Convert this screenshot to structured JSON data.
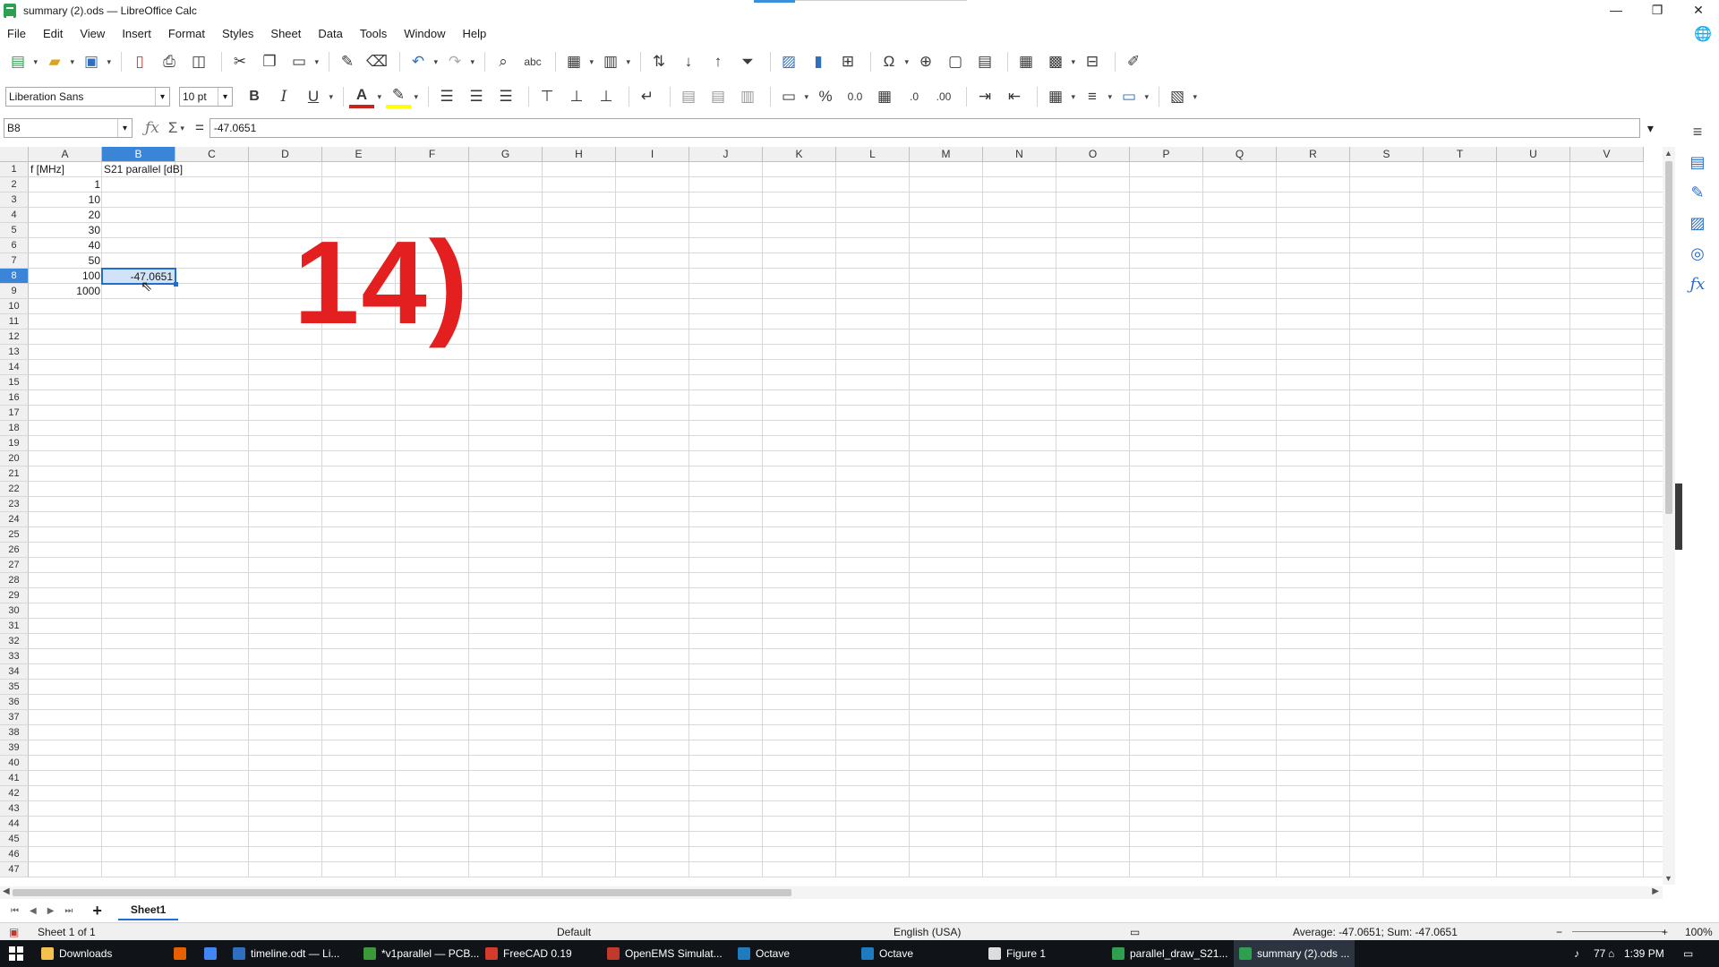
{
  "window": {
    "title": "summary (2).ods — LibreOffice Calc",
    "minimize": "—",
    "restore": "❐",
    "close": "✕"
  },
  "menu": [
    "File",
    "Edit",
    "View",
    "Insert",
    "Format",
    "Styles",
    "Sheet",
    "Data",
    "Tools",
    "Window",
    "Help"
  ],
  "format_toolbar": {
    "font_name": "Liberation Sans",
    "font_size": "10 pt",
    "bold": "B",
    "italic": "I",
    "underline": "U",
    "percent": "%",
    "number": "0.0"
  },
  "formula_bar": {
    "cell_ref": "B8",
    "formula": "-47.0651"
  },
  "columns": [
    "A",
    "B",
    "C",
    "D",
    "E",
    "F",
    "G",
    "H",
    "I",
    "J",
    "K",
    "L",
    "M",
    "N",
    "O",
    "P",
    "Q",
    "R",
    "S",
    "T",
    "U",
    "V"
  ],
  "selected_column": "B",
  "selected_row": "8",
  "rows": [
    "1",
    "2",
    "3",
    "4",
    "5",
    "6",
    "7",
    "8",
    "9",
    "10",
    "11",
    "12",
    "13",
    "14",
    "15",
    "16",
    "17",
    "18",
    "19",
    "20",
    "21",
    "22",
    "23",
    "24",
    "25",
    "26",
    "27",
    "28",
    "29",
    "30",
    "31",
    "32",
    "33",
    "34",
    "35",
    "36",
    "37",
    "38",
    "39",
    "40",
    "41",
    "42",
    "43",
    "44",
    "45",
    "46",
    "47"
  ],
  "cells": {
    "A1": "f [MHz]",
    "B1": "S21 parallel [dB]",
    "A2": "1",
    "A3": "10",
    "A4": "20",
    "A5": "30",
    "A6": "40",
    "A7": "50",
    "A8": "100",
    "B8": "-47.0651",
    "A9": "1000"
  },
  "annotation": "14)",
  "sheet_tabs": {
    "add": "+",
    "active": "Sheet1"
  },
  "status": {
    "sheet": "Sheet 1 of 1",
    "page_style": "Default",
    "language": "English (USA)",
    "selection": "Average: -47.0651; Sum: -47.0651",
    "zoom": "100%"
  },
  "taskbar": {
    "items": [
      {
        "label": "Downloads",
        "color": "#f2c14e"
      },
      {
        "label": "",
        "color": "#e66000"
      },
      {
        "label": "",
        "color": "#4285f4"
      },
      {
        "label": "timeline.odt — Li...",
        "color": "#2f6fc0"
      },
      {
        "label": "*v1parallel — PCB...",
        "color": "#3a9a3a"
      },
      {
        "label": "FreeCAD 0.19",
        "color": "#d43b2b"
      },
      {
        "label": "OpenEMS Simulat...",
        "color": "#c0392b"
      },
      {
        "label": "Octave",
        "color": "#1f7bc0"
      },
      {
        "label": "Octave",
        "color": "#1f7bc0"
      },
      {
        "label": "Figure 1",
        "color": "#dddddd"
      },
      {
        "label": "parallel_draw_S21...",
        "color": "#2e9e4f"
      },
      {
        "label": "summary (2).ods ...",
        "color": "#2e9e4f"
      }
    ],
    "tray_num": "77",
    "time": "1:39 PM"
  }
}
